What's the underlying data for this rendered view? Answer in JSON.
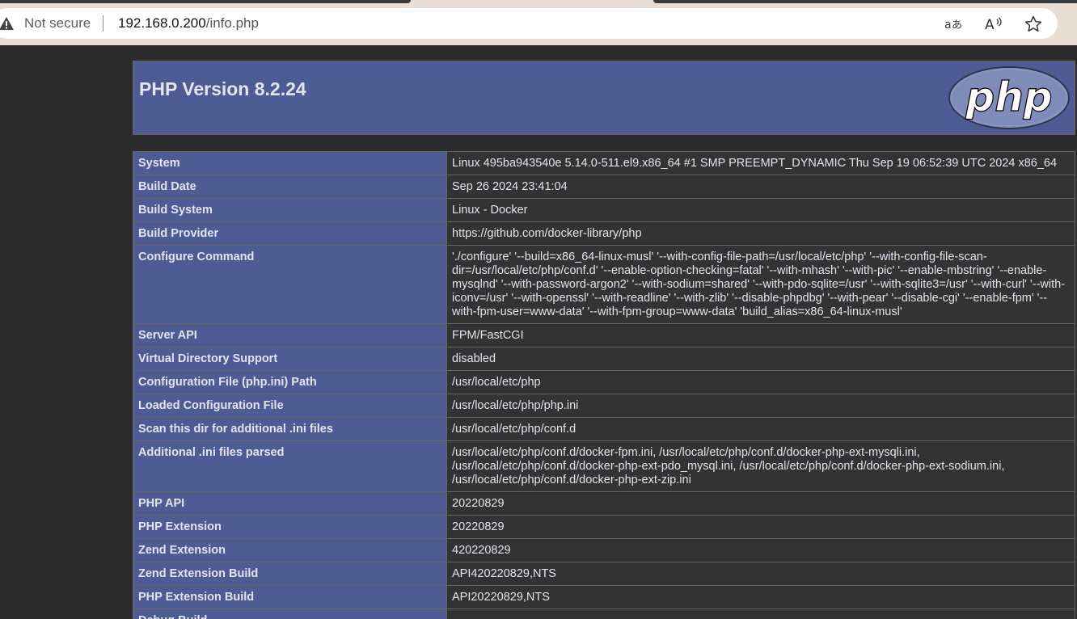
{
  "browser": {
    "security_label": "Not secure",
    "url_host": "192.168.0.200",
    "url_path": "/info.php",
    "icons": [
      "warning-icon",
      "translate-icon",
      "read-aloud-icon",
      "favorite-star-icon"
    ]
  },
  "header": {
    "title": "PHP Version 8.2.24",
    "logo_text": "php"
  },
  "rows": [
    {
      "key": "System",
      "value": "Linux 495ba943540e 5.14.0-511.el9.x86_64 #1 SMP PREEMPT_DYNAMIC Thu Sep 19 06:52:39 UTC 2024 x86_64"
    },
    {
      "key": "Build Date",
      "value": "Sep 26 2024 23:41:04"
    },
    {
      "key": "Build System",
      "value": "Linux - Docker"
    },
    {
      "key": "Build Provider",
      "value": "https://github.com/docker-library/php"
    },
    {
      "key": "Configure Command",
      "value": "'./configure' '--build=x86_64-linux-musl' '--with-config-file-path=/usr/local/etc/php' '--with-config-file-scan-dir=/usr/local/etc/php/conf.d' '--enable-option-checking=fatal' '--with-mhash' '--with-pic' '--enable-mbstring' '--enable-mysqlnd' '--with-password-argon2' '--with-sodium=shared' '--with-pdo-sqlite=/usr' '--with-sqlite3=/usr' '--with-curl' '--with-iconv=/usr' '--with-openssl' '--with-readline' '--with-zlib' '--disable-phpdbg' '--with-pear' '--disable-cgi' '--enable-fpm' '--with-fpm-user=www-data' '--with-fpm-group=www-data' 'build_alias=x86_64-linux-musl'"
    },
    {
      "key": "Server API",
      "value": "FPM/FastCGI"
    },
    {
      "key": "Virtual Directory Support",
      "value": "disabled"
    },
    {
      "key": "Configuration File (php.ini) Path",
      "value": "/usr/local/etc/php"
    },
    {
      "key": "Loaded Configuration File",
      "value": "/usr/local/etc/php/php.ini"
    },
    {
      "key": "Scan this dir for additional .ini files",
      "value": "/usr/local/etc/php/conf.d"
    },
    {
      "key": "Additional .ini files parsed",
      "value": "/usr/local/etc/php/conf.d/docker-fpm.ini, /usr/local/etc/php/conf.d/docker-php-ext-mysqli.ini, /usr/local/etc/php/conf.d/docker-php-ext-pdo_mysql.ini, /usr/local/etc/php/conf.d/docker-php-ext-sodium.ini, /usr/local/etc/php/conf.d/docker-php-ext-zip.ini"
    },
    {
      "key": "PHP API",
      "value": "20220829"
    },
    {
      "key": "PHP Extension",
      "value": "20220829"
    },
    {
      "key": "Zend Extension",
      "value": "420220829"
    },
    {
      "key": "Zend Extension Build",
      "value": "API420220829,NTS"
    },
    {
      "key": "PHP Extension Build",
      "value": "API20220829,NTS"
    },
    {
      "key": "Debug Build",
      "value": ""
    }
  ]
}
